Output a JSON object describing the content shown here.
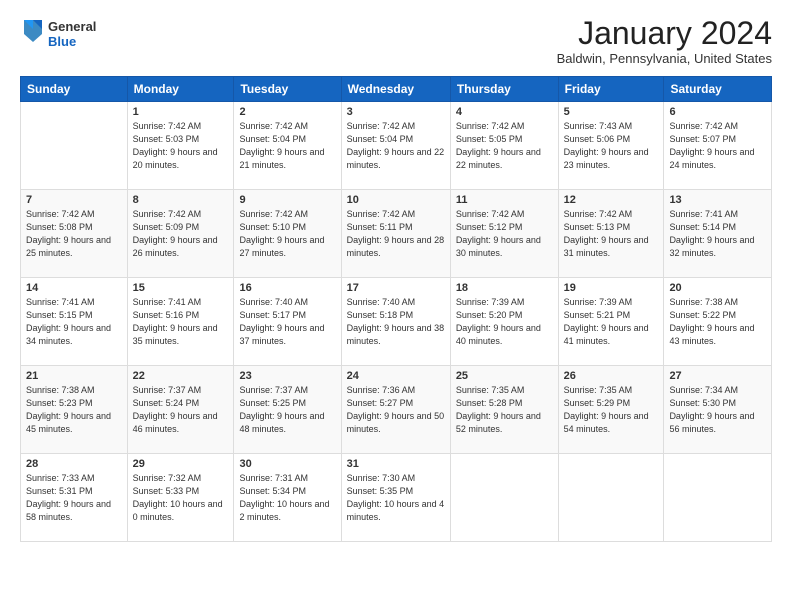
{
  "logo": {
    "general": "General",
    "blue": "Blue"
  },
  "header": {
    "month": "January 2024",
    "location": "Baldwin, Pennsylvania, United States"
  },
  "weekdays": [
    "Sunday",
    "Monday",
    "Tuesday",
    "Wednesday",
    "Thursday",
    "Friday",
    "Saturday"
  ],
  "weeks": [
    [
      {
        "day": "",
        "sunrise": "",
        "sunset": "",
        "daylight": ""
      },
      {
        "day": "1",
        "sunrise": "Sunrise: 7:42 AM",
        "sunset": "Sunset: 5:03 PM",
        "daylight": "Daylight: 9 hours and 20 minutes."
      },
      {
        "day": "2",
        "sunrise": "Sunrise: 7:42 AM",
        "sunset": "Sunset: 5:04 PM",
        "daylight": "Daylight: 9 hours and 21 minutes."
      },
      {
        "day": "3",
        "sunrise": "Sunrise: 7:42 AM",
        "sunset": "Sunset: 5:04 PM",
        "daylight": "Daylight: 9 hours and 22 minutes."
      },
      {
        "day": "4",
        "sunrise": "Sunrise: 7:42 AM",
        "sunset": "Sunset: 5:05 PM",
        "daylight": "Daylight: 9 hours and 22 minutes."
      },
      {
        "day": "5",
        "sunrise": "Sunrise: 7:43 AM",
        "sunset": "Sunset: 5:06 PM",
        "daylight": "Daylight: 9 hours and 23 minutes."
      },
      {
        "day": "6",
        "sunrise": "Sunrise: 7:42 AM",
        "sunset": "Sunset: 5:07 PM",
        "daylight": "Daylight: 9 hours and 24 minutes."
      }
    ],
    [
      {
        "day": "7",
        "sunrise": "Sunrise: 7:42 AM",
        "sunset": "Sunset: 5:08 PM",
        "daylight": "Daylight: 9 hours and 25 minutes."
      },
      {
        "day": "8",
        "sunrise": "Sunrise: 7:42 AM",
        "sunset": "Sunset: 5:09 PM",
        "daylight": "Daylight: 9 hours and 26 minutes."
      },
      {
        "day": "9",
        "sunrise": "Sunrise: 7:42 AM",
        "sunset": "Sunset: 5:10 PM",
        "daylight": "Daylight: 9 hours and 27 minutes."
      },
      {
        "day": "10",
        "sunrise": "Sunrise: 7:42 AM",
        "sunset": "Sunset: 5:11 PM",
        "daylight": "Daylight: 9 hours and 28 minutes."
      },
      {
        "day": "11",
        "sunrise": "Sunrise: 7:42 AM",
        "sunset": "Sunset: 5:12 PM",
        "daylight": "Daylight: 9 hours and 30 minutes."
      },
      {
        "day": "12",
        "sunrise": "Sunrise: 7:42 AM",
        "sunset": "Sunset: 5:13 PM",
        "daylight": "Daylight: 9 hours and 31 minutes."
      },
      {
        "day": "13",
        "sunrise": "Sunrise: 7:41 AM",
        "sunset": "Sunset: 5:14 PM",
        "daylight": "Daylight: 9 hours and 32 minutes."
      }
    ],
    [
      {
        "day": "14",
        "sunrise": "Sunrise: 7:41 AM",
        "sunset": "Sunset: 5:15 PM",
        "daylight": "Daylight: 9 hours and 34 minutes."
      },
      {
        "day": "15",
        "sunrise": "Sunrise: 7:41 AM",
        "sunset": "Sunset: 5:16 PM",
        "daylight": "Daylight: 9 hours and 35 minutes."
      },
      {
        "day": "16",
        "sunrise": "Sunrise: 7:40 AM",
        "sunset": "Sunset: 5:17 PM",
        "daylight": "Daylight: 9 hours and 37 minutes."
      },
      {
        "day": "17",
        "sunrise": "Sunrise: 7:40 AM",
        "sunset": "Sunset: 5:18 PM",
        "daylight": "Daylight: 9 hours and 38 minutes."
      },
      {
        "day": "18",
        "sunrise": "Sunrise: 7:39 AM",
        "sunset": "Sunset: 5:20 PM",
        "daylight": "Daylight: 9 hours and 40 minutes."
      },
      {
        "day": "19",
        "sunrise": "Sunrise: 7:39 AM",
        "sunset": "Sunset: 5:21 PM",
        "daylight": "Daylight: 9 hours and 41 minutes."
      },
      {
        "day": "20",
        "sunrise": "Sunrise: 7:38 AM",
        "sunset": "Sunset: 5:22 PM",
        "daylight": "Daylight: 9 hours and 43 minutes."
      }
    ],
    [
      {
        "day": "21",
        "sunrise": "Sunrise: 7:38 AM",
        "sunset": "Sunset: 5:23 PM",
        "daylight": "Daylight: 9 hours and 45 minutes."
      },
      {
        "day": "22",
        "sunrise": "Sunrise: 7:37 AM",
        "sunset": "Sunset: 5:24 PM",
        "daylight": "Daylight: 9 hours and 46 minutes."
      },
      {
        "day": "23",
        "sunrise": "Sunrise: 7:37 AM",
        "sunset": "Sunset: 5:25 PM",
        "daylight": "Daylight: 9 hours and 48 minutes."
      },
      {
        "day": "24",
        "sunrise": "Sunrise: 7:36 AM",
        "sunset": "Sunset: 5:27 PM",
        "daylight": "Daylight: 9 hours and 50 minutes."
      },
      {
        "day": "25",
        "sunrise": "Sunrise: 7:35 AM",
        "sunset": "Sunset: 5:28 PM",
        "daylight": "Daylight: 9 hours and 52 minutes."
      },
      {
        "day": "26",
        "sunrise": "Sunrise: 7:35 AM",
        "sunset": "Sunset: 5:29 PM",
        "daylight": "Daylight: 9 hours and 54 minutes."
      },
      {
        "day": "27",
        "sunrise": "Sunrise: 7:34 AM",
        "sunset": "Sunset: 5:30 PM",
        "daylight": "Daylight: 9 hours and 56 minutes."
      }
    ],
    [
      {
        "day": "28",
        "sunrise": "Sunrise: 7:33 AM",
        "sunset": "Sunset: 5:31 PM",
        "daylight": "Daylight: 9 hours and 58 minutes."
      },
      {
        "day": "29",
        "sunrise": "Sunrise: 7:32 AM",
        "sunset": "Sunset: 5:33 PM",
        "daylight": "Daylight: 10 hours and 0 minutes."
      },
      {
        "day": "30",
        "sunrise": "Sunrise: 7:31 AM",
        "sunset": "Sunset: 5:34 PM",
        "daylight": "Daylight: 10 hours and 2 minutes."
      },
      {
        "day": "31",
        "sunrise": "Sunrise: 7:30 AM",
        "sunset": "Sunset: 5:35 PM",
        "daylight": "Daylight: 10 hours and 4 minutes."
      },
      {
        "day": "",
        "sunrise": "",
        "sunset": "",
        "daylight": ""
      },
      {
        "day": "",
        "sunrise": "",
        "sunset": "",
        "daylight": ""
      },
      {
        "day": "",
        "sunrise": "",
        "sunset": "",
        "daylight": ""
      }
    ]
  ]
}
